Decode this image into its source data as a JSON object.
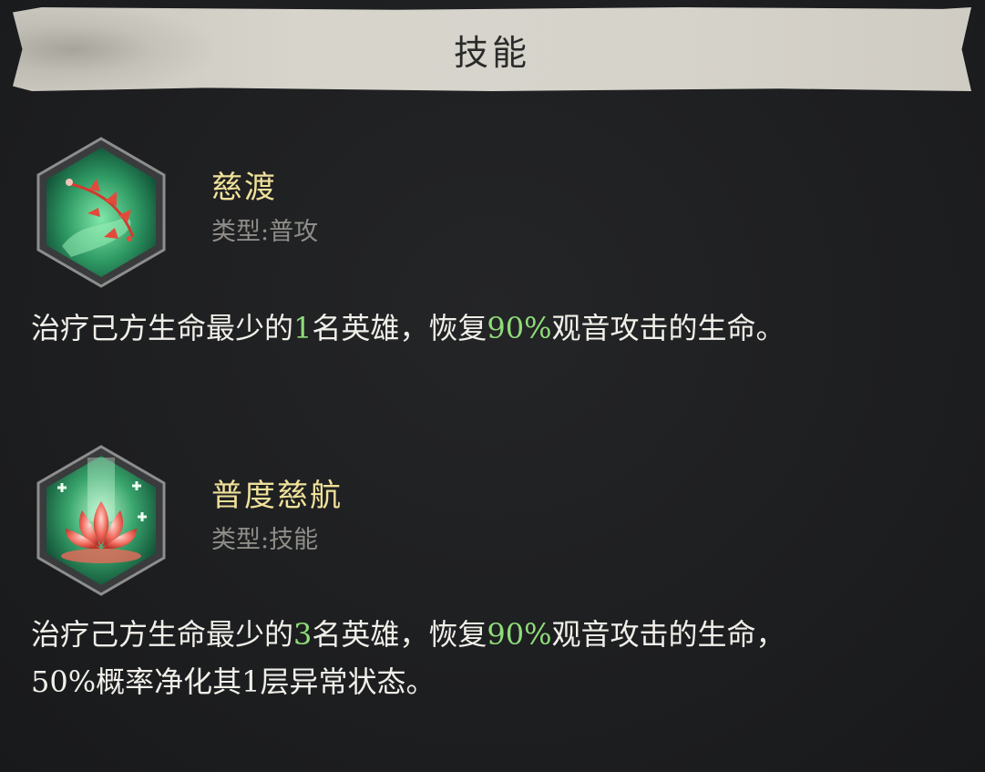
{
  "header": {
    "title": "技能"
  },
  "skills": [
    {
      "icon": "healing-branch-icon",
      "name": "慈渡",
      "type": "类型:普攻",
      "desc_parts": [
        "治疗己方生命最少的",
        "1",
        "名英雄，恢复",
        "90%",
        "观音攻击的生命。"
      ],
      "desc_line2": ""
    },
    {
      "icon": "lotus-icon",
      "name": "普度慈航",
      "type": "类型:技能",
      "desc_parts": [
        "治疗己方生命最少的",
        "3",
        "名英雄，恢复",
        "90%",
        "观音攻击的生命，"
      ],
      "desc_line2": "50%概率净化其1层异常状态。"
    }
  ],
  "colors": {
    "skill_name": "#efe19a",
    "highlight": "#8fdc7a",
    "type_text": "#8e8d88",
    "body_text": "#f1efe9"
  }
}
